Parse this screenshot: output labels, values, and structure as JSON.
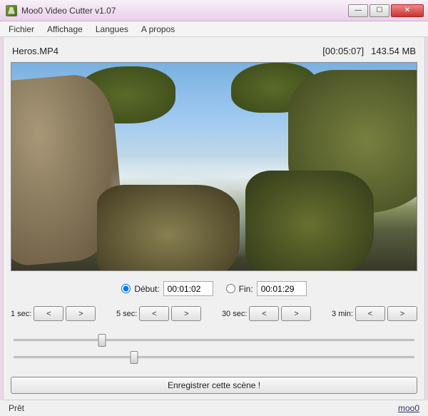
{
  "window": {
    "title": "Moo0 Video Cutter v1.07"
  },
  "menu": {
    "items": [
      "Fichier",
      "Affichage",
      "Langues",
      "A propos"
    ]
  },
  "file": {
    "name": "Heros.MP4",
    "duration": "[00:05:07]",
    "size": "143.54 MB"
  },
  "controls": {
    "start_label": "Début:",
    "start_value": "00:01:02",
    "end_label": "Fin:",
    "end_value": "00:01:29"
  },
  "seek": {
    "groups": [
      {
        "label": "1 sec:"
      },
      {
        "label": "5 sec:"
      },
      {
        "label": "30 sec:"
      },
      {
        "label": "3 min:"
      }
    ],
    "prev_glyph": "<",
    "next_glyph": ">"
  },
  "sliders": {
    "start_pos_pct": 22,
    "end_pos_pct": 30
  },
  "save": {
    "label": "Enregistrer cette scène !"
  },
  "status": {
    "text": "Prêt",
    "link": "moo0"
  }
}
